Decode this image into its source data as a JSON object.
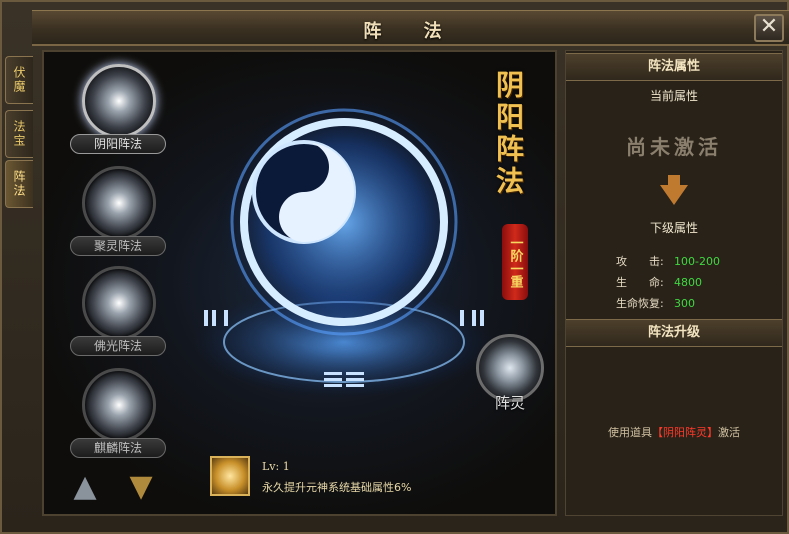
{
  "window": {
    "title": "阵 法",
    "close_label": "✕"
  },
  "side_tabs": [
    {
      "label": "伏魔"
    },
    {
      "label": "法宝"
    },
    {
      "label": "阵法"
    }
  ],
  "skills": [
    {
      "label": "阴阳阵法"
    },
    {
      "label": "聚灵阵法"
    },
    {
      "label": "佛光阵法"
    },
    {
      "label": "麒麟阵法"
    }
  ],
  "main": {
    "title_vertical": "阴阳阵法",
    "rank_badge": "一阶一重",
    "spirit_label": "阵灵",
    "item_level": "Lv: 1",
    "item_desc": "永久提升元神系统基础属性6%"
  },
  "right": {
    "attr_header": "阵法属性",
    "current_header": "当前属性",
    "status": "尚未激活",
    "next_header": "下级属性",
    "attributes": [
      {
        "name": "攻　　击:",
        "value": "100-200"
      },
      {
        "name": "生　　命:",
        "value": "4800"
      },
      {
        "name": "生命恢复:",
        "value": "300"
      }
    ],
    "upgrade_header": "阵法升级",
    "hint_prefix": "使用道具",
    "hint_item": "【阴阳阵灵】",
    "hint_suffix": "激活"
  },
  "colors": {
    "accent_gold": "#f0c050",
    "attr_value_green": "#40d840",
    "hint_item_red": "#ff3a2a"
  }
}
